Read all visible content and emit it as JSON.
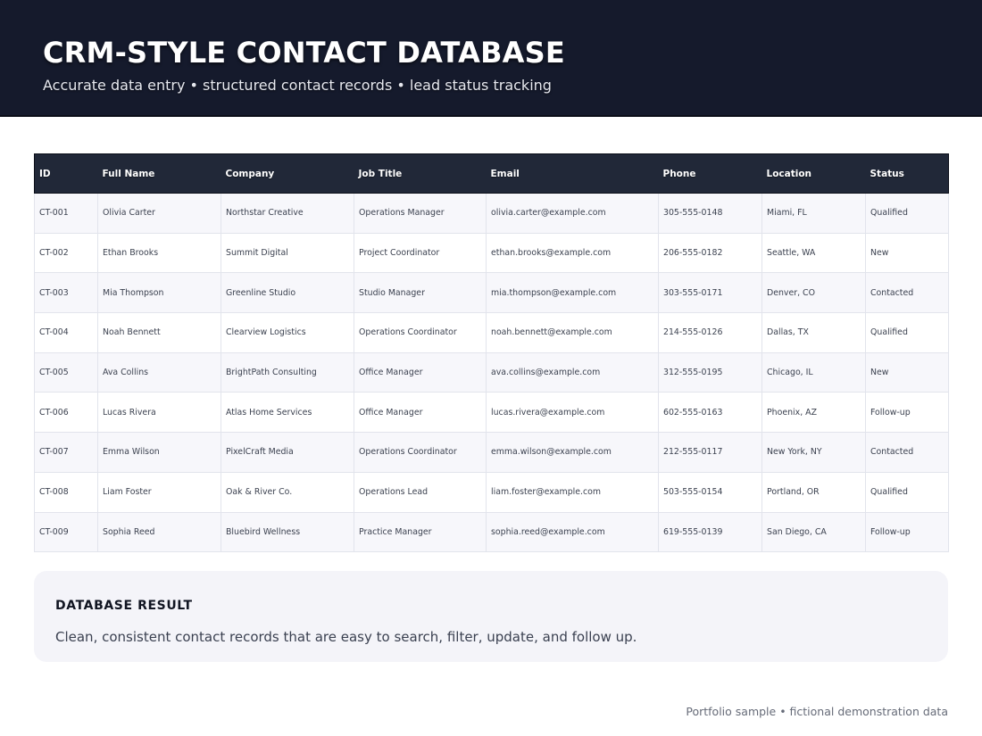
{
  "header": {
    "title": "CRM-STYLE CONTACT DATABASE",
    "subtitle": "Accurate data entry • structured contact records • lead status tracking"
  },
  "table": {
    "columns": [
      "ID",
      "Full Name",
      "Company",
      "Job Title",
      "Email",
      "Phone",
      "Location",
      "Status"
    ],
    "rows": [
      [
        "CT-001",
        "Olivia Carter",
        "Northstar Creative",
        "Operations Manager",
        "olivia.carter@example.com",
        "305-555-0148",
        "Miami, FL",
        "Qualified"
      ],
      [
        "CT-002",
        "Ethan Brooks",
        "Summit Digital",
        "Project Coordinator",
        "ethan.brooks@example.com",
        "206-555-0182",
        "Seattle, WA",
        "New"
      ],
      [
        "CT-003",
        "Mia Thompson",
        "Greenline Studio",
        "Studio Manager",
        "mia.thompson@example.com",
        "303-555-0171",
        "Denver, CO",
        "Contacted"
      ],
      [
        "CT-004",
        "Noah Bennett",
        "Clearview Logistics",
        "Operations Coordinator",
        "noah.bennett@example.com",
        "214-555-0126",
        "Dallas, TX",
        "Qualified"
      ],
      [
        "CT-005",
        "Ava Collins",
        "BrightPath Consulting",
        "Office Manager",
        "ava.collins@example.com",
        "312-555-0195",
        "Chicago, IL",
        "New"
      ],
      [
        "CT-006",
        "Lucas Rivera",
        "Atlas Home Services",
        "Office Manager",
        "lucas.rivera@example.com",
        "602-555-0163",
        "Phoenix, AZ",
        "Follow-up"
      ],
      [
        "CT-007",
        "Emma Wilson",
        "PixelCraft Media",
        "Operations Coordinator",
        "emma.wilson@example.com",
        "212-555-0117",
        "New York, NY",
        "Contacted"
      ],
      [
        "CT-008",
        "Liam Foster",
        "Oak & River Co.",
        "Operations Lead",
        "liam.foster@example.com",
        "503-555-0154",
        "Portland, OR",
        "Qualified"
      ],
      [
        "CT-009",
        "Sophia Reed",
        "Bluebird Wellness",
        "Practice Manager",
        "sophia.reed@example.com",
        "619-555-0139",
        "San Diego, CA",
        "Follow-up"
      ]
    ]
  },
  "result": {
    "title": "DATABASE RESULT",
    "text": "Clean, consistent contact records that are easy to search, filter, update, and follow up."
  },
  "footer": {
    "note": "Portfolio sample • fictional demonstration data"
  },
  "colors": {
    "header_bg": "#151a2c",
    "table_header_bg": "#212838",
    "row_alt_bg": "#f7f7fb",
    "result_bg": "#f4f4f9"
  }
}
